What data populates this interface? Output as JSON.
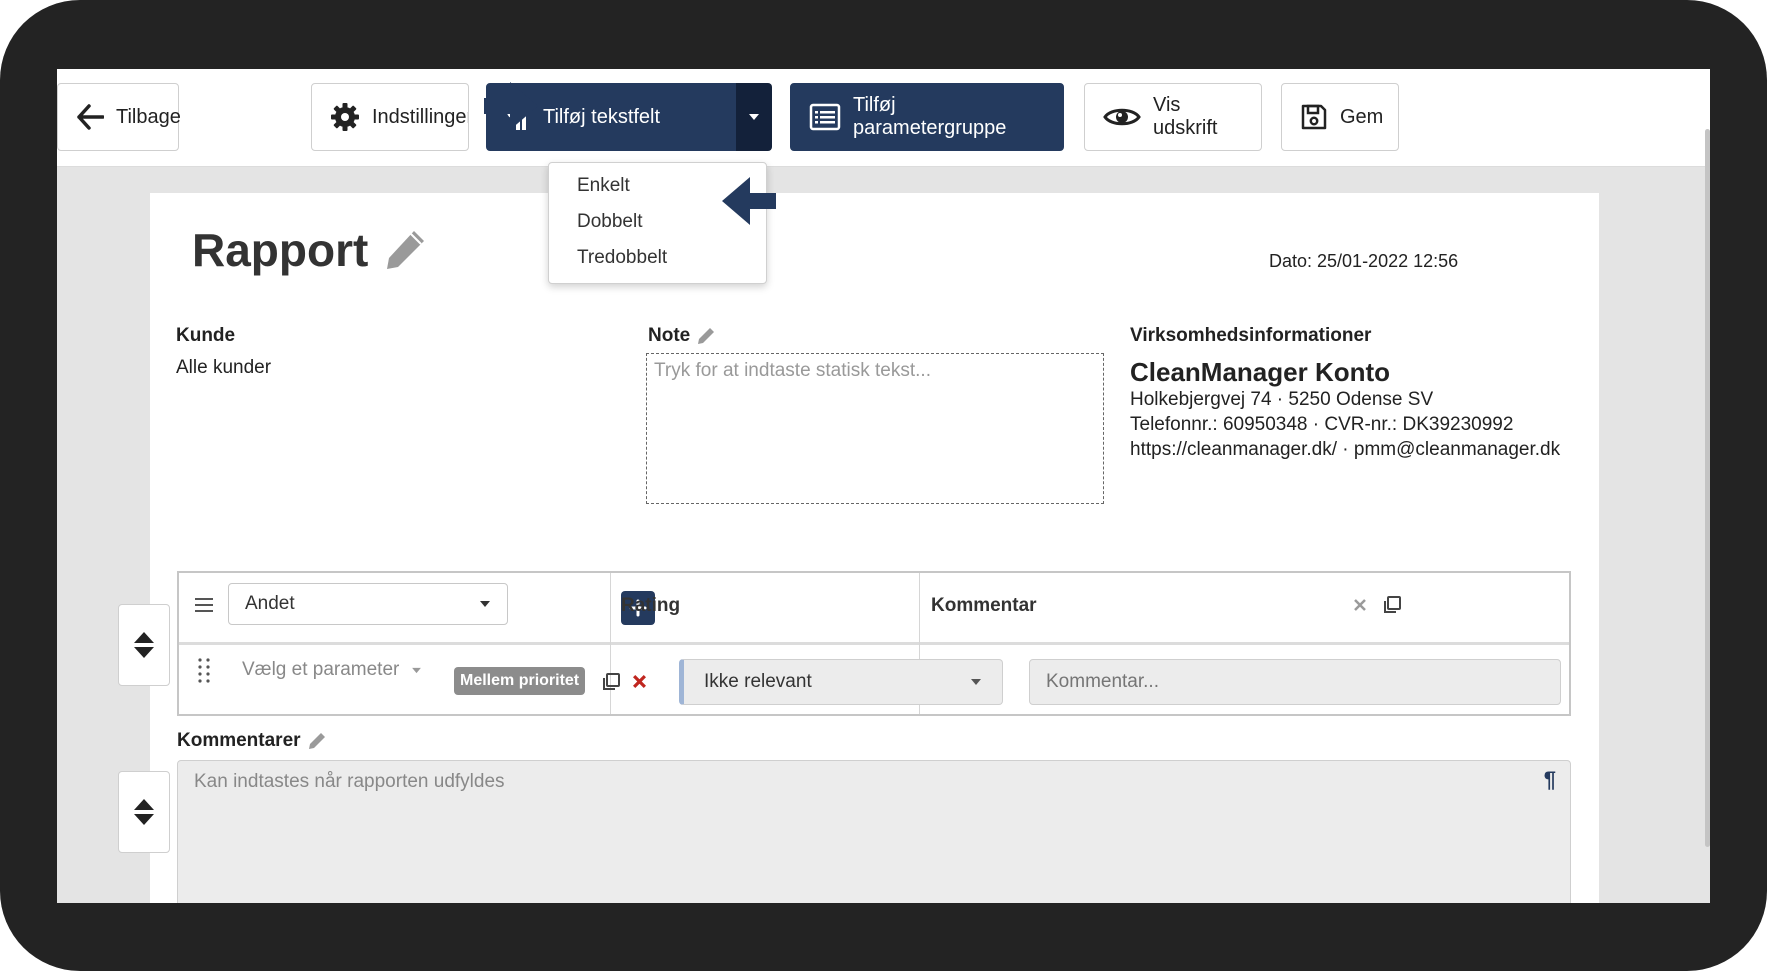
{
  "toolbar": {
    "back_label": "Tilbage",
    "settings_label": "Indstillinger",
    "add_textfield_label": "Tilføj tekstfelt",
    "add_paramgroup_label": "Tilføj parametergruppe",
    "print_label": "Vis udskrift",
    "save_label": "Gem"
  },
  "dropdown": {
    "items": [
      {
        "label": "Enkelt"
      },
      {
        "label": "Dobbelt"
      },
      {
        "label": "Tredobbelt"
      }
    ]
  },
  "report": {
    "title": "Rapport",
    "date": "Dato: 25/01-2022 12:56",
    "customer_label": "Kunde",
    "customer_value": "Alle kunder",
    "note_label": "Note",
    "note_placeholder": "Tryk for at indtaste statisk tekst...",
    "company_label": "Virksomhedsinformationer",
    "company_name": "CleanManager Konto",
    "company_address": "Holkebjergvej 74 · 5250 Odense SV",
    "company_phone": "Telefonnr.: 60950348 · CVR-nr.: DK39230992",
    "company_web": "https://cleanmanager.dk/ · pmm@cleanmanager.dk"
  },
  "param_table": {
    "group_select": "Andet",
    "rating_header": "Rating",
    "comment_header": "Kommentar",
    "param_placeholder": "Vælg et parameter",
    "priority_badge": "Mellem prioritet",
    "rating_value": "Ikke relevant",
    "comment_placeholder": "Kommentar..."
  },
  "comments": {
    "label": "Kommentarer",
    "placeholder": "Kan indtastes når rapporten udfyldes",
    "pilcrow": "¶"
  },
  "colors": {
    "primary": "#243a5e",
    "primary_dark": "#13213a",
    "frame": "#232323",
    "canvas": "#e4e4e4",
    "delete_red": "#c0261f"
  }
}
